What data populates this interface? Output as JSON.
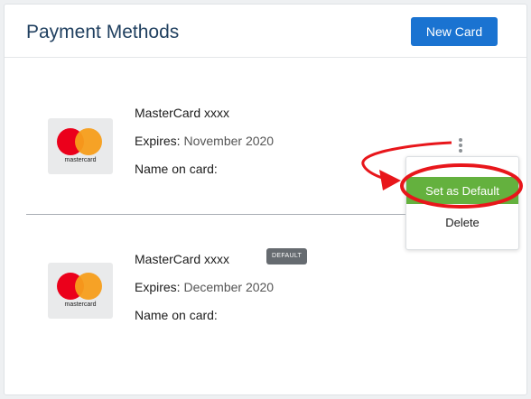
{
  "header": {
    "title": "Payment Methods",
    "new_card_label": "New Card"
  },
  "cards": [
    {
      "name": "MasterCard xxxx",
      "expires_label": "Expires:",
      "expires_value": "November 2020",
      "name_on_card_label": "Name on card:",
      "logo_text": "mastercard",
      "is_default": false
    },
    {
      "name": "MasterCard xxxx",
      "badge": "DEFAULT",
      "expires_label": "Expires:",
      "expires_value": "December 2020",
      "name_on_card_label": "Name on card:",
      "logo_text": "mastercard",
      "is_default": true
    }
  ],
  "menu": {
    "set_default_label": "Set as Default",
    "delete_label": "Delete"
  },
  "icons": {
    "kebab": "kebab-menu-icon",
    "logo": "mastercard-logo-icon"
  },
  "colors": {
    "primary": "#1a73d1",
    "success": "#64b13e",
    "annotation": "#e8161b",
    "title": "#1f3f5f"
  }
}
